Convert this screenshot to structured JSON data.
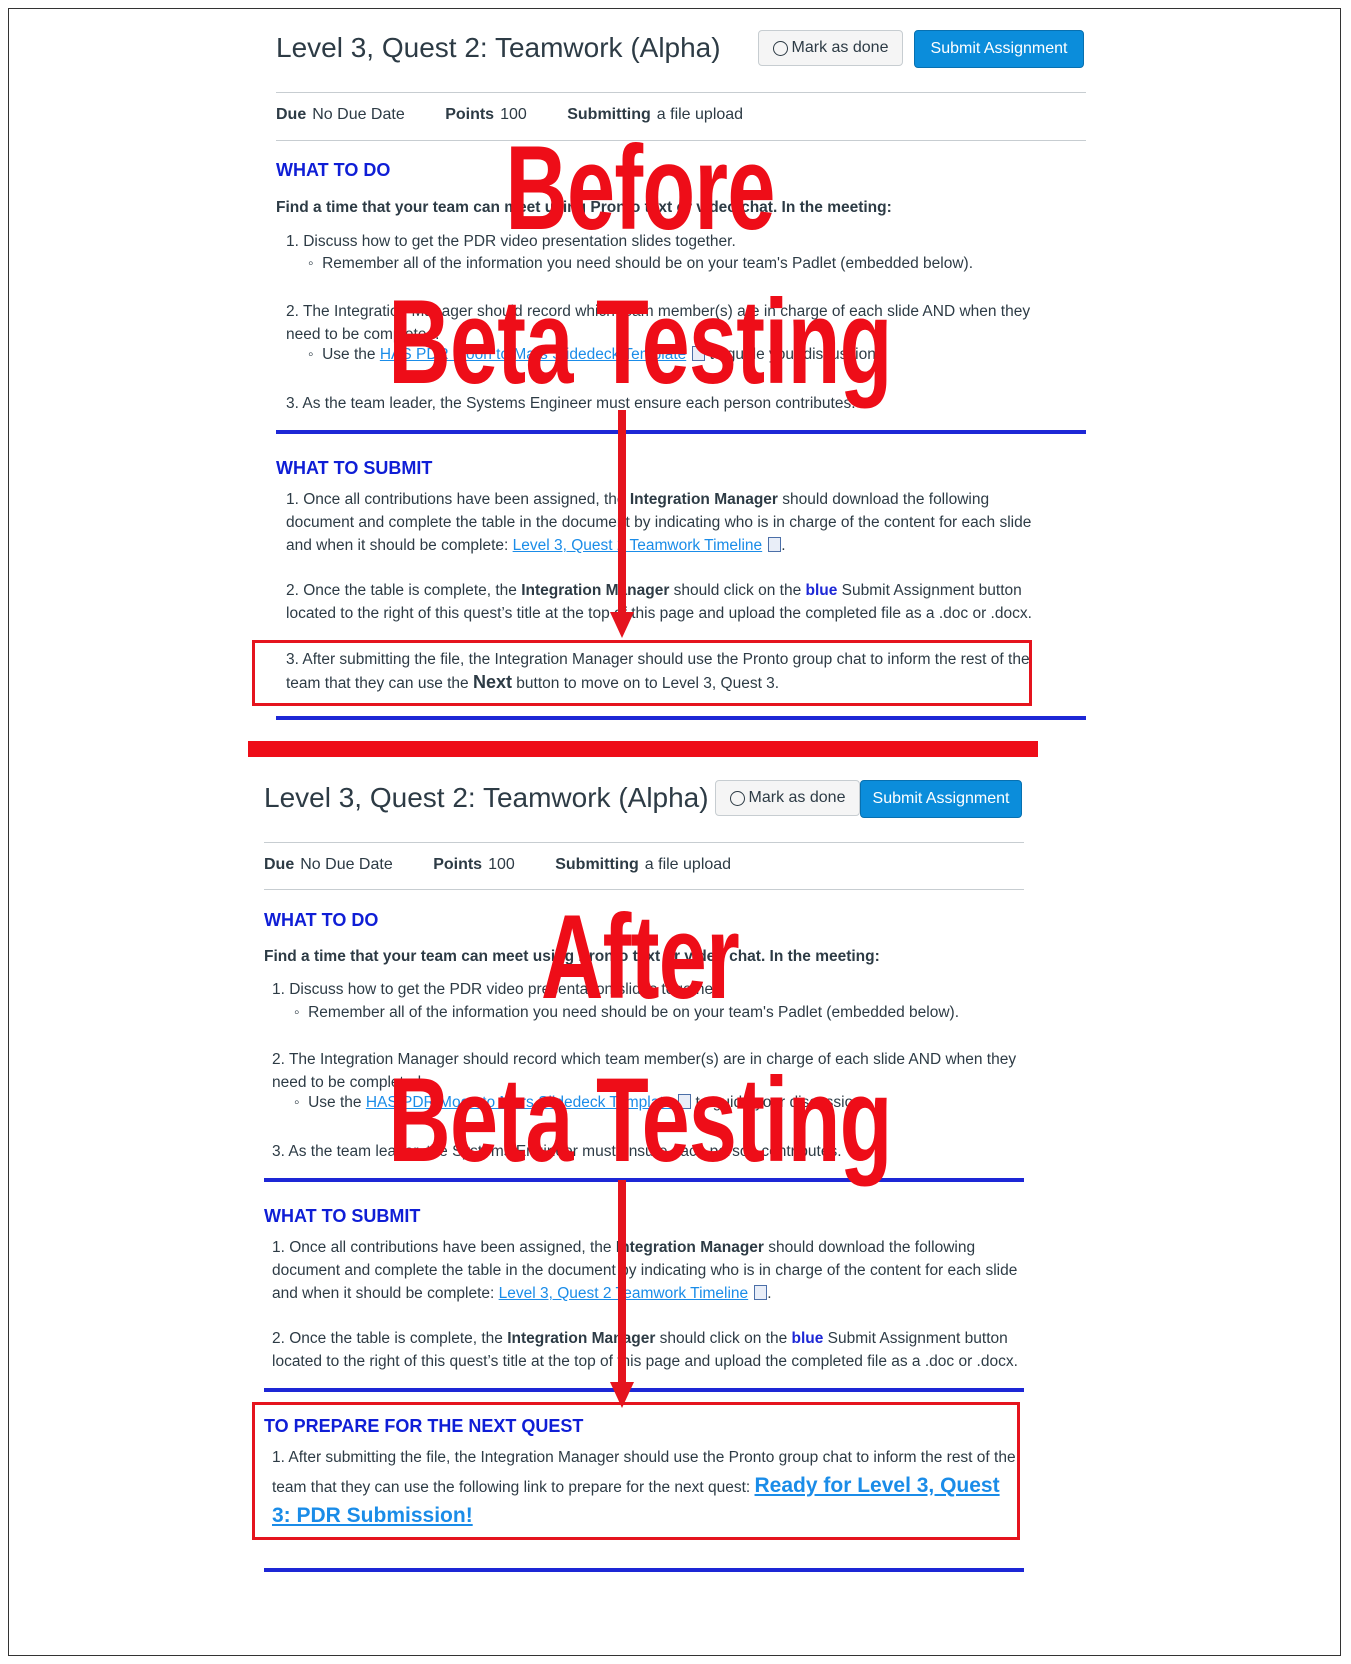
{
  "before": {
    "title": "Level 3, Quest 2: Teamwork (Alpha)",
    "mark_done": "Mark as done",
    "submit": "Submit Assignment",
    "due_label": "Due",
    "due_value": "No Due Date",
    "points_label": "Points",
    "points_value": "100",
    "submitting_label": "Submitting",
    "submitting_value": "a file upload",
    "what_to_do": "WHAT TO DO",
    "intro": "Find a time that your team can meet using Pronto text or video chat. In the meeting:",
    "todo1": "1. Discuss how to get the PDR video presentation slides together.",
    "todo1_sub": "Remember all of the information you need should be on your team's Padlet (embedded below).",
    "todo2": "2. The Integration Manager should record which team member(s) are in charge of each slide AND when they need to be completed.",
    "todo2_sub_pre": "Use the ",
    "todo2_sub_link": "HAS PDR Moon to Mars Slidedeck Template",
    "todo2_sub_post": " to guide your discussion.",
    "todo3": "3. As the team leader, the Systems Engineer must ensure each person contributes.",
    "what_to_submit": "WHAT TO SUBMIT",
    "sub1_pre": "1. Once all contributions have been assigned, the ",
    "sub1_bold": "Integration Manager",
    "sub1_mid": " should download the following document and complete the table in the document by indicating who is in charge of the content for each slide and when it should be complete: ",
    "sub1_link": "Level 3, Quest 2 Teamwork Timeline",
    "sub2_pre": "2. Once the table is complete, the ",
    "sub2_bold": "Integration Manager",
    "sub2_mid": " should click on the ",
    "sub2_blue": "blue",
    "sub2_post": " Submit Assignment button located to the right of this quest’s title at the top of this page and upload the completed file as a .doc or .docx.",
    "sub3_pre": "3. After submitting the file, the Integration Manager should use the Pronto group chat to inform the rest of the team that they can use the ",
    "sub3_next": "Next",
    "sub3_post": " button to move on to Level 3, Quest 3.",
    "overlay1": "Before",
    "overlay2": "Beta Testing"
  },
  "after": {
    "title": "Level 3, Quest 2: Teamwork (Alpha)",
    "mark_done": "Mark as done",
    "submit": "Submit Assignment",
    "due_label": "Due",
    "due_value": "No Due Date",
    "points_label": "Points",
    "points_value": "100",
    "submitting_label": "Submitting",
    "submitting_value": "a file upload",
    "what_to_do": "WHAT TO DO",
    "intro": "Find a time that your team can meet using Pronto text or video chat. In the meeting:",
    "todo1": "1. Discuss how to get the PDR video presentation slides together.",
    "todo1_sub": "Remember all of the information you need should be on your team's Padlet (embedded below).",
    "todo2": "2. The Integration Manager should record which team member(s) are in charge of each slide AND when they need to be completed.",
    "todo2_sub_pre": "Use the ",
    "todo2_sub_link": "HAS PDR Moon to Mars Slidedeck Template",
    "todo2_sub_post": " to guide your discussion.",
    "todo3": "3. As the team leader, the Systems Engineer must ensure each person contributes.",
    "what_to_submit": "WHAT TO SUBMIT",
    "sub1_pre": "1. Once all contributions have been assigned, the ",
    "sub1_bold": "Integration Manager",
    "sub1_mid": " should download the following document and complete the table in the document by indicating who is in charge of the content for each slide and when it should be complete: ",
    "sub1_link": "Level 3, Quest 2 Teamwork Timeline",
    "sub2_pre": "2. Once the table is complete, the ",
    "sub2_bold": "Integration Manager",
    "sub2_mid": " should click on the ",
    "sub2_blue": "blue",
    "sub2_post": " Submit Assignment button located to the right of this quest’s title at the top of this page and upload the completed file as a .doc or .docx.",
    "prepare_heading": "TO PREPARE FOR THE NEXT QUEST",
    "prep1_pre": "1. After submitting the file, the Integration Manager should use the Pronto group chat to inform the rest of the team that they can use the following link to prepare for the next quest: ",
    "prep1_link": "Ready for Level 3, Quest 3: PDR Submission!",
    "overlay1": "After",
    "overlay2": "Beta Testing"
  }
}
